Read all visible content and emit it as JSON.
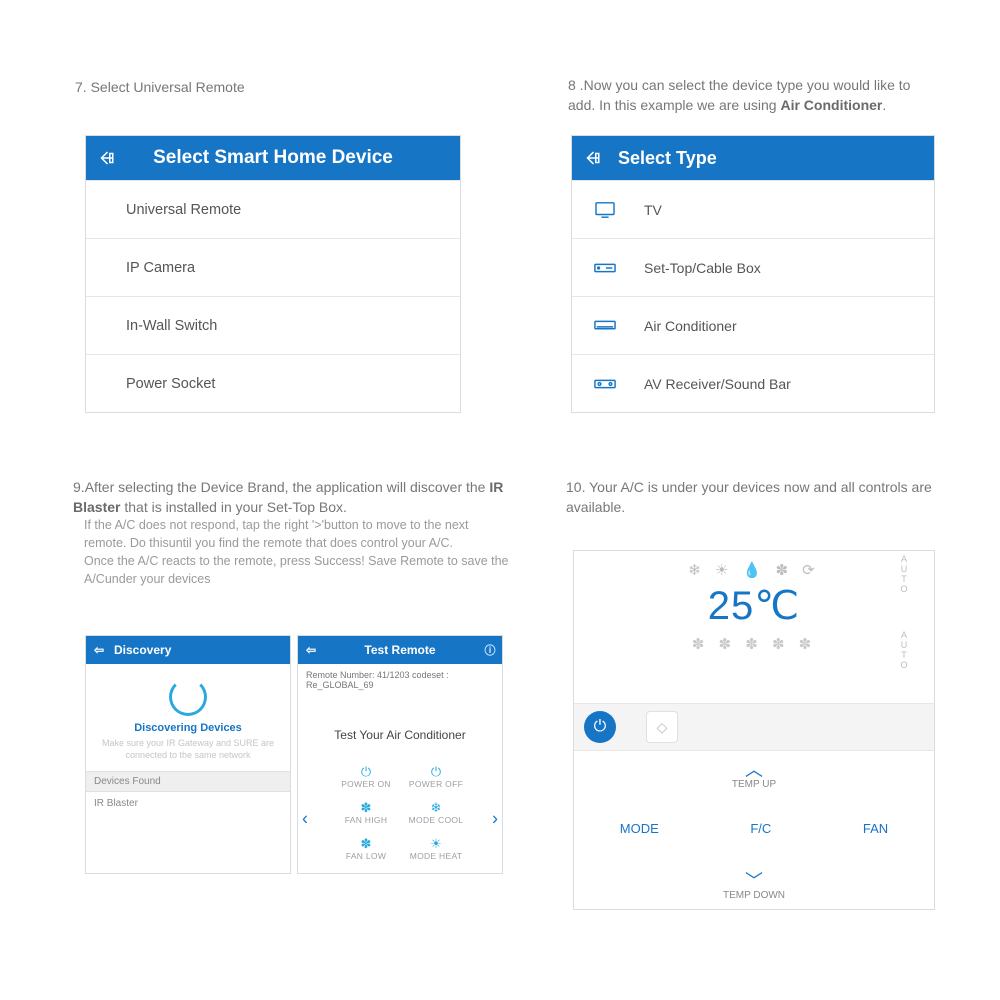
{
  "step7": {
    "num": "7.",
    "text": "Select Universal Remote",
    "header": "Select Smart Home Device",
    "items": [
      "Universal Remote",
      "IP Camera",
      "In-Wall Switch",
      "Power Socket"
    ]
  },
  "step8": {
    "num": "8 .",
    "text_a": "Now you can select the device type you would like to add. In this example we are using ",
    "text_bold": "Air Conditioner",
    "text_b": ".",
    "header": "Select Type",
    "items": [
      {
        "icon": "tv",
        "label": "TV"
      },
      {
        "icon": "stb",
        "label": "Set-Top/Cable Box"
      },
      {
        "icon": "ac",
        "label": "Air Conditioner"
      },
      {
        "icon": "avr",
        "label": "AV Receiver/Sound Bar"
      }
    ]
  },
  "step9": {
    "num": "9.",
    "text_a": "After selecting the Device Brand, the application will discover the ",
    "text_bold": "IR Blaster",
    "text_b": " that is installed in your Set-Top Box.",
    "sub": "If the A/C does not respond, tap the right '>'button to move to the next remote. Do thisuntil you find the remote that does control your A/C.\nOnce the A/C reacts to the remote, press Success! Save Remote to save the A/Cunder your devices",
    "discovery": {
      "header": "Discovery",
      "title": "Discovering Devices",
      "sub": "Make sure your IR Gateway and SURE are connected to the same network",
      "found_head": "Devices Found",
      "found_item": "IR Blaster"
    },
    "test": {
      "header": "Test Remote",
      "rn": "Remote Number: 41/1203 codeset : Re_GLOBAL_69",
      "title": "Test Your Air Conditioner",
      "buttons": {
        "power_on": "POWER ON",
        "power_off": "POWER OFF",
        "fan_high": "FAN HIGH",
        "mode_cool": "MODE COOL",
        "fan_low": "FAN LOW",
        "mode_heat": "MODE HEAT"
      }
    }
  },
  "step10": {
    "num": "10.",
    "text": "Your A/C is under your devices now and all controls are available.",
    "auto": "AUTO",
    "temp": "25℃",
    "temp_up": "TEMP UP",
    "temp_down": "TEMP DOWN",
    "mode": "MODE",
    "fc": "F/C",
    "fan": "FAN"
  }
}
